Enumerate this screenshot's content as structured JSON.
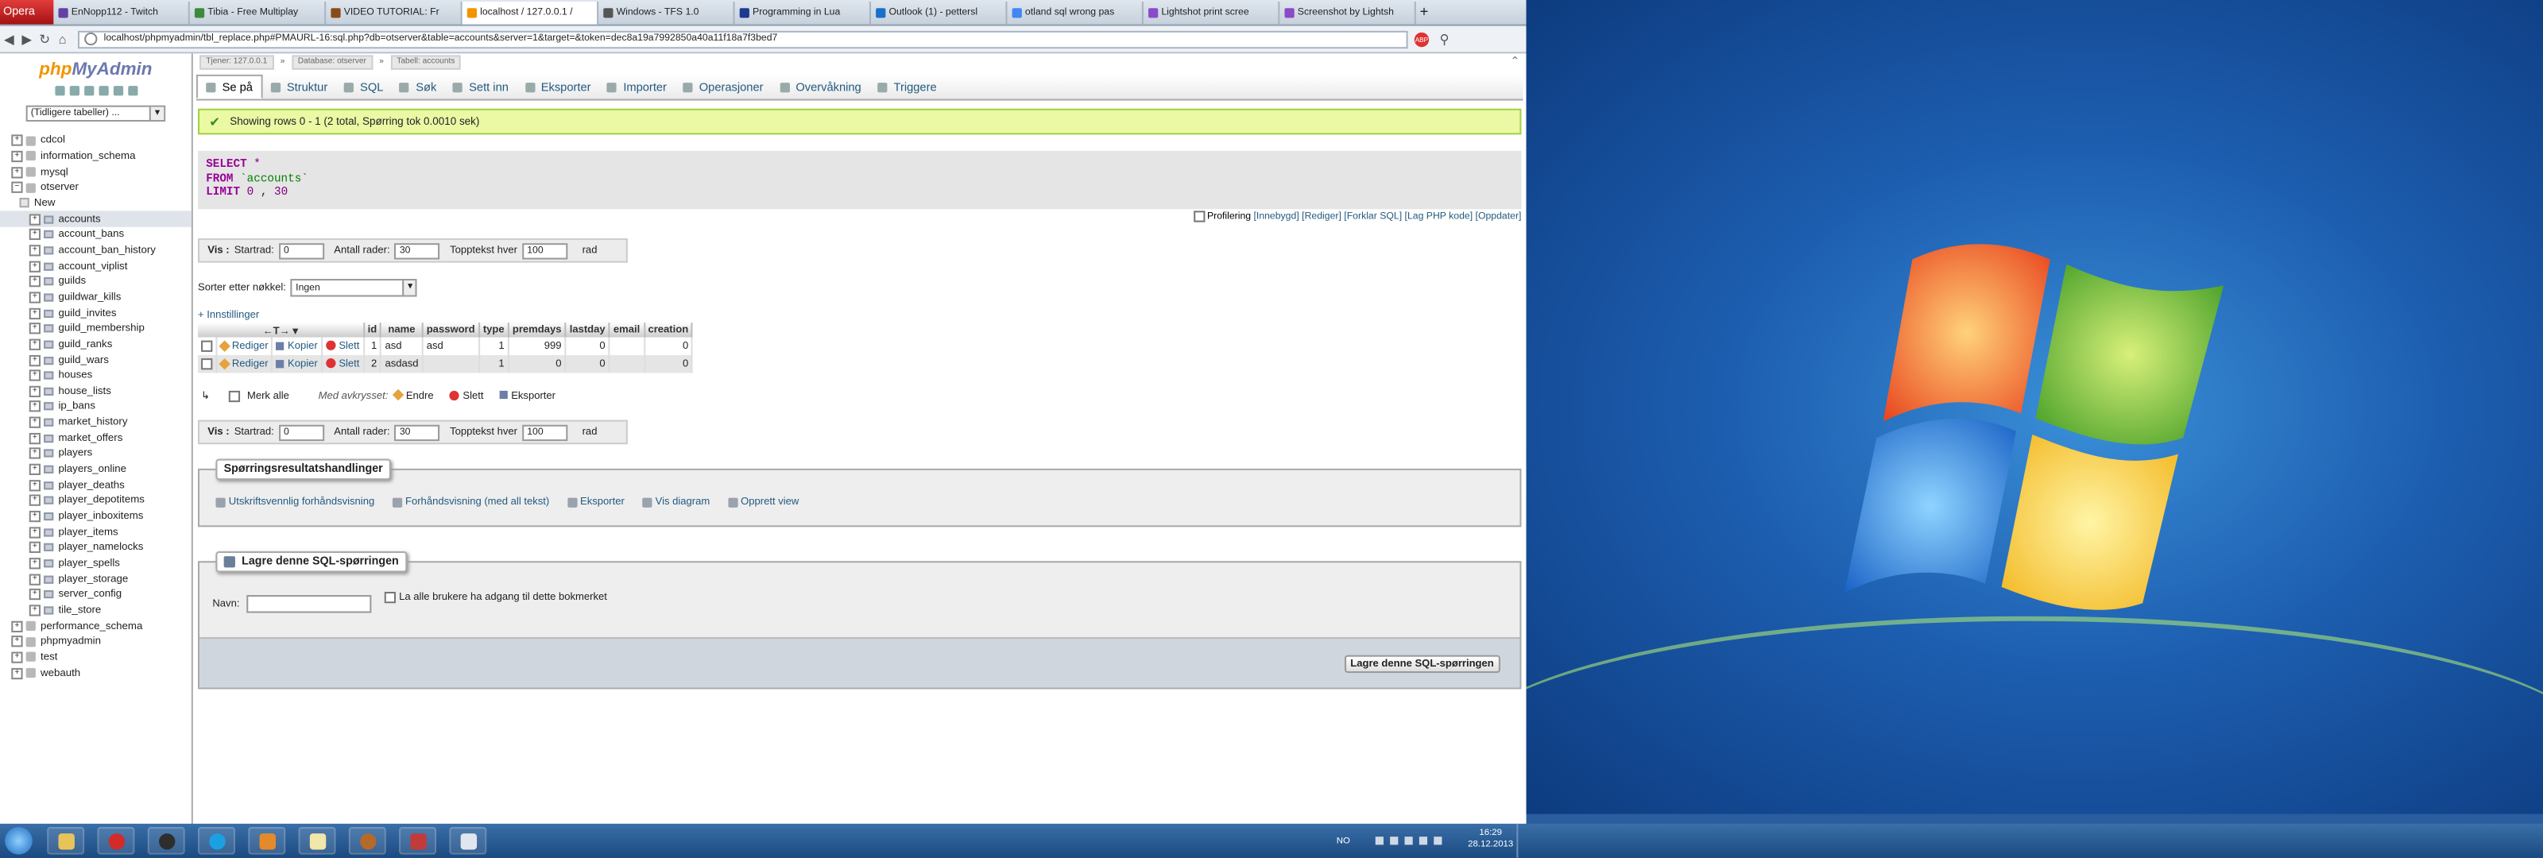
{
  "browser": {
    "menu_label": "Opera",
    "tabs": [
      {
        "title": "EnNopp112 - Twitch",
        "color": "#6441a5"
      },
      {
        "title": "Tibia - Free Multiplay",
        "color": "#3c8a3c"
      },
      {
        "title": "VIDEO TUTORIAL: Fr",
        "color": "#8a4b1b"
      },
      {
        "title": "localhost / 127.0.0.1 /",
        "color": "#f29400",
        "active": true
      },
      {
        "title": "Windows - TFS 1.0",
        "color": "#555555"
      },
      {
        "title": "Programming in Lua",
        "color": "#1d3a8f"
      },
      {
        "title": "Outlook (1) - pettersl",
        "color": "#1a6fc9"
      },
      {
        "title": "otland sql wrong pas",
        "color": "#4285f4"
      },
      {
        "title": "Lightshot print scree",
        "color": "#8a4bc9"
      },
      {
        "title": "Screenshot by Lightsh",
        "color": "#8a4bc9"
      }
    ],
    "address": "localhost/phpmyadmin/tbl_replace.php#PMAURL-16:sql.php?db=otserver&table=accounts&server=1&target=&token=dec8a19a7992850a40a11f18a7f3bed7",
    "adblock_label": "ABP"
  },
  "sidebar": {
    "logo_php": "php",
    "logo_my": "MyAdmin",
    "recent_tables": "(Tidligere tabeller) ...",
    "databases_before": [
      "cdcol",
      "information_schema",
      "mysql"
    ],
    "open_db": "otserver",
    "new_label": "New",
    "tables": [
      "accounts",
      "account_bans",
      "account_ban_history",
      "account_viplist",
      "guilds",
      "guildwar_kills",
      "guild_invites",
      "guild_membership",
      "guild_ranks",
      "guild_wars",
      "houses",
      "house_lists",
      "ip_bans",
      "market_history",
      "market_offers",
      "players",
      "players_online",
      "player_deaths",
      "player_depotitems",
      "player_inboxitems",
      "player_items",
      "player_namelocks",
      "player_spells",
      "player_storage",
      "server_config",
      "tile_store"
    ],
    "selected_table": "accounts",
    "databases_after": [
      "performance_schema",
      "phpmyadmin",
      "test",
      "webauth"
    ]
  },
  "breadcrumb": {
    "server": "Tjener: 127.0.0.1",
    "database": "Database: otserver",
    "table": "Tabell: accounts"
  },
  "menu": [
    "Se på",
    "Struktur",
    "SQL",
    "Søk",
    "Sett inn",
    "Eksporter",
    "Importer",
    "Operasjoner",
    "Overvåkning",
    "Triggere"
  ],
  "message": "Showing rows 0 - 1 (2 total, Spørring tok 0.0010 sek)",
  "sql": {
    "select_kw": "SELECT",
    "star": "*",
    "from_kw": "FROM",
    "table": "`accounts`",
    "limit_kw": "LIMIT",
    "limit_a": "0",
    "comma": ",",
    "limit_b": "30"
  },
  "profiling": {
    "label": "Profilering",
    "links": [
      "Innebygd",
      "Rediger",
      "Forklar SQL",
      "Lag PHP kode",
      "Oppdater"
    ]
  },
  "nav": {
    "vis": "Vis :",
    "start_label": "Startrad:",
    "start_value": "0",
    "rows_label": "Antall rader:",
    "rows_value": "30",
    "header_label": "Topptekst hver",
    "header_value": "100",
    "unit": "rad"
  },
  "sort": {
    "label": "Sorter etter nøkkel:",
    "value": "Ingen"
  },
  "options_link": "+ Innstillinger",
  "table": {
    "columns": [
      "id",
      "name",
      "password",
      "type",
      "premdays",
      "lastday",
      "email",
      "creation"
    ],
    "actions": {
      "edit": "Rediger",
      "copy": "Kopier",
      "delete": "Slett"
    },
    "rows": [
      {
        "id": "1",
        "name": "asd",
        "password": "asd",
        "type": "1",
        "premdays": "999",
        "lastday": "0",
        "email": "",
        "creation": "0"
      },
      {
        "id": "2",
        "name": "asdasd",
        "password": "",
        "type": "1",
        "premdays": "0",
        "lastday": "0",
        "email": "",
        "creation": "0"
      }
    ]
  },
  "with_selected": {
    "check_all": "Merk alle",
    "label": "Med avkrysset:",
    "edit": "Endre",
    "delete": "Slett",
    "export": "Eksporter"
  },
  "query_ops": {
    "legend": "Spørringsresultatshandlinger",
    "items": [
      "Utskriftsvennlig forhåndsvisning",
      "Forhåndsvisning (med all tekst)",
      "Eksporter",
      "Vis diagram",
      "Opprett view"
    ]
  },
  "bookmark": {
    "legend": "Lagre denne SQL-spørringen",
    "name_label": "Navn:",
    "name_value": "",
    "all_users": "La alle brukere ha adgang til dette bokmerket",
    "submit": "Lagre denne SQL-spørringen"
  },
  "tray": {
    "lang": "NO",
    "time": "16:29",
    "date": "28.12.2013"
  }
}
